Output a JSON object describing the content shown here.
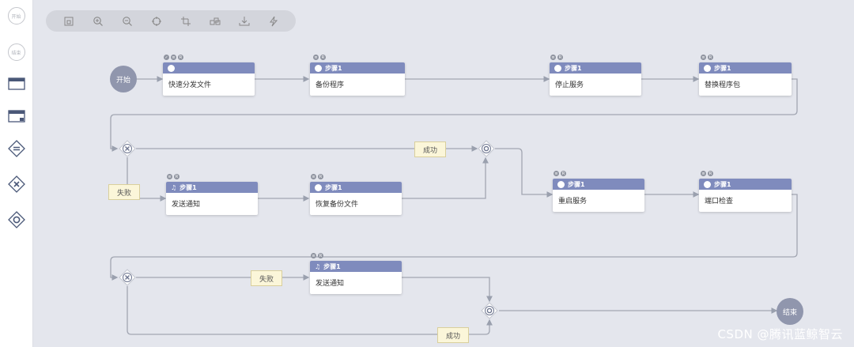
{
  "sidebar": {
    "start_label": "开始",
    "end_label": "结束"
  },
  "toolbar": {
    "icons": [
      "fit-view-icon",
      "zoom-in-icon",
      "zoom-out-icon",
      "locate-icon",
      "crop-icon",
      "layout-icon",
      "download-icon",
      "flash-icon"
    ]
  },
  "flow": {
    "start": "开始",
    "end": "结束",
    "step_label": "步骤1",
    "nodes": {
      "quick_dispatch": "快速分发文件",
      "backup": "备份程序",
      "stop_service": "停止服务",
      "replace_package": "替换程序包",
      "notify_1": "发送通知",
      "restore_backup": "恢复备份文件",
      "restart_service": "重启服务",
      "port_check": "端口检查",
      "notify_2": "发送通知"
    },
    "labels": {
      "success_1": "成功",
      "fail_1": "失败",
      "fail_2": "失败",
      "success_2": "成功"
    }
  },
  "watermark": "CSDN @腾讯蓝鲸智云"
}
